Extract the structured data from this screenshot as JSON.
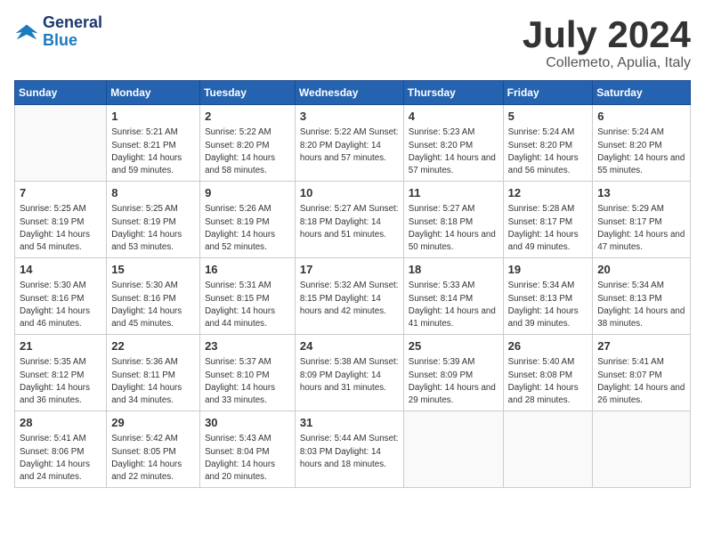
{
  "header": {
    "logo_line1": "General",
    "logo_line2": "Blue",
    "title": "July 2024",
    "subtitle": "Collemeto, Apulia, Italy"
  },
  "columns": [
    "Sunday",
    "Monday",
    "Tuesday",
    "Wednesday",
    "Thursday",
    "Friday",
    "Saturday"
  ],
  "weeks": [
    [
      {
        "day": "",
        "info": ""
      },
      {
        "day": "1",
        "info": "Sunrise: 5:21 AM\nSunset: 8:21 PM\nDaylight: 14 hours\nand 59 minutes."
      },
      {
        "day": "2",
        "info": "Sunrise: 5:22 AM\nSunset: 8:20 PM\nDaylight: 14 hours\nand 58 minutes."
      },
      {
        "day": "3",
        "info": "Sunrise: 5:22 AM\nSunset: 8:20 PM\nDaylight: 14 hours\nand 57 minutes."
      },
      {
        "day": "4",
        "info": "Sunrise: 5:23 AM\nSunset: 8:20 PM\nDaylight: 14 hours\nand 57 minutes."
      },
      {
        "day": "5",
        "info": "Sunrise: 5:24 AM\nSunset: 8:20 PM\nDaylight: 14 hours\nand 56 minutes."
      },
      {
        "day": "6",
        "info": "Sunrise: 5:24 AM\nSunset: 8:20 PM\nDaylight: 14 hours\nand 55 minutes."
      }
    ],
    [
      {
        "day": "7",
        "info": "Sunrise: 5:25 AM\nSunset: 8:19 PM\nDaylight: 14 hours\nand 54 minutes."
      },
      {
        "day": "8",
        "info": "Sunrise: 5:25 AM\nSunset: 8:19 PM\nDaylight: 14 hours\nand 53 minutes."
      },
      {
        "day": "9",
        "info": "Sunrise: 5:26 AM\nSunset: 8:19 PM\nDaylight: 14 hours\nand 52 minutes."
      },
      {
        "day": "10",
        "info": "Sunrise: 5:27 AM\nSunset: 8:18 PM\nDaylight: 14 hours\nand 51 minutes."
      },
      {
        "day": "11",
        "info": "Sunrise: 5:27 AM\nSunset: 8:18 PM\nDaylight: 14 hours\nand 50 minutes."
      },
      {
        "day": "12",
        "info": "Sunrise: 5:28 AM\nSunset: 8:17 PM\nDaylight: 14 hours\nand 49 minutes."
      },
      {
        "day": "13",
        "info": "Sunrise: 5:29 AM\nSunset: 8:17 PM\nDaylight: 14 hours\nand 47 minutes."
      }
    ],
    [
      {
        "day": "14",
        "info": "Sunrise: 5:30 AM\nSunset: 8:16 PM\nDaylight: 14 hours\nand 46 minutes."
      },
      {
        "day": "15",
        "info": "Sunrise: 5:30 AM\nSunset: 8:16 PM\nDaylight: 14 hours\nand 45 minutes."
      },
      {
        "day": "16",
        "info": "Sunrise: 5:31 AM\nSunset: 8:15 PM\nDaylight: 14 hours\nand 44 minutes."
      },
      {
        "day": "17",
        "info": "Sunrise: 5:32 AM\nSunset: 8:15 PM\nDaylight: 14 hours\nand 42 minutes."
      },
      {
        "day": "18",
        "info": "Sunrise: 5:33 AM\nSunset: 8:14 PM\nDaylight: 14 hours\nand 41 minutes."
      },
      {
        "day": "19",
        "info": "Sunrise: 5:34 AM\nSunset: 8:13 PM\nDaylight: 14 hours\nand 39 minutes."
      },
      {
        "day": "20",
        "info": "Sunrise: 5:34 AM\nSunset: 8:13 PM\nDaylight: 14 hours\nand 38 minutes."
      }
    ],
    [
      {
        "day": "21",
        "info": "Sunrise: 5:35 AM\nSunset: 8:12 PM\nDaylight: 14 hours\nand 36 minutes."
      },
      {
        "day": "22",
        "info": "Sunrise: 5:36 AM\nSunset: 8:11 PM\nDaylight: 14 hours\nand 34 minutes."
      },
      {
        "day": "23",
        "info": "Sunrise: 5:37 AM\nSunset: 8:10 PM\nDaylight: 14 hours\nand 33 minutes."
      },
      {
        "day": "24",
        "info": "Sunrise: 5:38 AM\nSunset: 8:09 PM\nDaylight: 14 hours\nand 31 minutes."
      },
      {
        "day": "25",
        "info": "Sunrise: 5:39 AM\nSunset: 8:09 PM\nDaylight: 14 hours\nand 29 minutes."
      },
      {
        "day": "26",
        "info": "Sunrise: 5:40 AM\nSunset: 8:08 PM\nDaylight: 14 hours\nand 28 minutes."
      },
      {
        "day": "27",
        "info": "Sunrise: 5:41 AM\nSunset: 8:07 PM\nDaylight: 14 hours\nand 26 minutes."
      }
    ],
    [
      {
        "day": "28",
        "info": "Sunrise: 5:41 AM\nSunset: 8:06 PM\nDaylight: 14 hours\nand 24 minutes."
      },
      {
        "day": "29",
        "info": "Sunrise: 5:42 AM\nSunset: 8:05 PM\nDaylight: 14 hours\nand 22 minutes."
      },
      {
        "day": "30",
        "info": "Sunrise: 5:43 AM\nSunset: 8:04 PM\nDaylight: 14 hours\nand 20 minutes."
      },
      {
        "day": "31",
        "info": "Sunrise: 5:44 AM\nSunset: 8:03 PM\nDaylight: 14 hours\nand 18 minutes."
      },
      {
        "day": "",
        "info": ""
      },
      {
        "day": "",
        "info": ""
      },
      {
        "day": "",
        "info": ""
      }
    ]
  ]
}
